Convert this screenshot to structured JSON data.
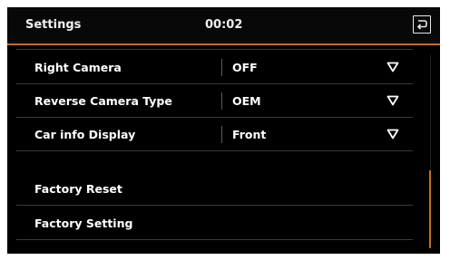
{
  "header": {
    "title": "Settings",
    "time": "00:02",
    "back_icon": "return-icon"
  },
  "rows": [
    {
      "label": "Right Camera",
      "value": "OFF",
      "has_dropdown": true
    },
    {
      "label": "Reverse Camera Type",
      "value": "OEM",
      "has_dropdown": true
    },
    {
      "label": "Car info Display",
      "value": "Front",
      "has_dropdown": true
    },
    {
      "label": "Factory Reset"
    },
    {
      "label": "Factory Setting"
    }
  ],
  "colors": {
    "background": "#000000",
    "accent": "#c46f1d",
    "text": "#ffffff"
  }
}
